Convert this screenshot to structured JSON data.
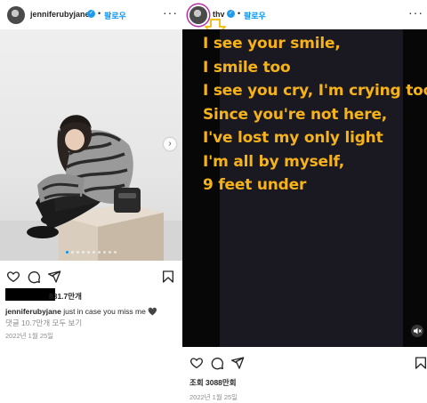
{
  "left_post": {
    "username": "jenniferubyjane",
    "follow_label": "팔로우",
    "separator": "•",
    "more_label": "···",
    "next_label": "›",
    "likes": "831.7만개",
    "caption_user": "jenniferubyjane",
    "caption_text": "just in case you miss me 🖤",
    "comments_link": "댓글 10.7만개 모두 보기",
    "date": "2022년 1월 25일",
    "carousel_count": 10,
    "carousel_active": 1
  },
  "right_post": {
    "username": "thv",
    "follow_label": "팔로우",
    "separator": "•",
    "more_label": "···",
    "lyrics": [
      "I see your smile,",
      "I smile too",
      "I see you cry, I'm crying too",
      "Since you're not here,",
      "I've lost my only light",
      "I'm all by myself,",
      "9 feet under"
    ],
    "views": "조회 3088만회",
    "date": "2022년 1월 25일"
  },
  "colors": {
    "lyric": "#f6b319",
    "link": "#0095f6",
    "verified": "#1d9bf0",
    "video_bg": "#070707",
    "panel_bg": "#1a1821"
  },
  "icons": [
    "heart-icon",
    "comment-icon",
    "share-icon",
    "bookmark-icon",
    "verified-icon",
    "mute-icon",
    "chevron-right-icon",
    "more-icon"
  ]
}
